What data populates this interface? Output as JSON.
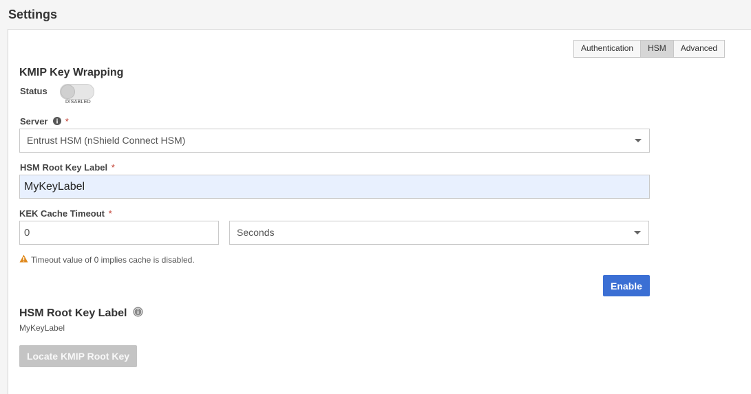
{
  "page": {
    "title": "Settings"
  },
  "tabs": [
    {
      "label": "Authentication"
    },
    {
      "label": "HSM"
    },
    {
      "label": "Advanced"
    }
  ],
  "kmip": {
    "title": "KMIP Key Wrapping",
    "status_label": "Status",
    "status_state": "DISABLED",
    "server_label": "Server",
    "server_value": "Entrust HSM (nShield Connect HSM)",
    "root_key_label": "HSM Root Key Label",
    "root_key_value": "MyKeyLabel",
    "kek_label": "KEK Cache Timeout",
    "kek_value": "0",
    "kek_unit": "Seconds",
    "warning": "Timeout value of 0 implies cache is disabled.",
    "required_mark": "*",
    "enable_button": "Enable"
  },
  "root_key_section": {
    "title": "HSM Root Key Label",
    "value": "MyKeyLabel",
    "locate_button": "Locate KMIP Root Key"
  },
  "colors": {
    "accent": "#3b6fd4",
    "required": "#c0392b",
    "warning": "#e08a1e",
    "highlight_field": "#e8f0fe"
  }
}
